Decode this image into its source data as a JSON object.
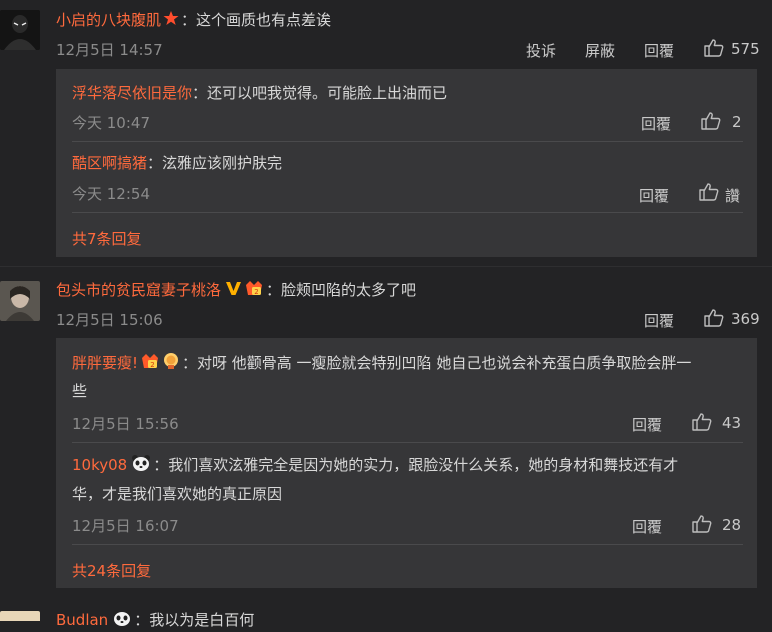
{
  "comments": [
    {
      "user": "小启的八块腹肌",
      "text": "：这个画质也有点差诶",
      "time": "12月5日 14:57",
      "actions": {
        "report": "投诉",
        "block": "屏蔽",
        "reply": "回覆"
      },
      "likes": "575",
      "replies": [
        {
          "user": "浮华落尽依旧是你",
          "text": "：还可以吧我觉得。可能脸上出油而已",
          "time": "今天 10:47",
          "reply": "回覆",
          "likes": "2"
        },
        {
          "user": "酷区啊搞猪",
          "text": "：泫雅应该刚护肤完",
          "time": "今天 12:54",
          "reply": "回覆",
          "likes": "讚"
        }
      ],
      "more": "共7条回复"
    },
    {
      "user": "包头市的贫民窟妻子桃洛",
      "text": "：脸颊凹陷的太多了吧",
      "time": "12月5日 15:06",
      "reply": "回覆",
      "likes": "369",
      "replies": [
        {
          "user": "胖胖要瘦!",
          "text_line1": "：对呀 他颧骨高 一瘦脸就会特别凹陷 她自己也说会补充蛋白质争取脸会胖一",
          "text_line2": "些",
          "time": "12月5日 15:56",
          "reply": "回覆",
          "likes": "43"
        },
        {
          "user": "10ky08",
          "text_line1": "：我们喜欢泫雅完全是因为她的实力，跟脸没什么关系，她的身材和舞技还有才",
          "text_line2": "华，才是我们喜欢她的真正原因",
          "time": "12月5日 16:07",
          "reply": "回覆",
          "likes": "28"
        }
      ],
      "more": "共24条回复"
    },
    {
      "user": "Budlan",
      "text": "：我以为是白百何"
    }
  ],
  "colors": {
    "background": "#232325",
    "reply_box": "#363638",
    "username": "#ff6a3d",
    "text": "#d8d8d8"
  },
  "icons": [
    "thumbs-up-icon",
    "star-icon",
    "v-badge-icon",
    "level-badge-icon",
    "panda-icon"
  ]
}
